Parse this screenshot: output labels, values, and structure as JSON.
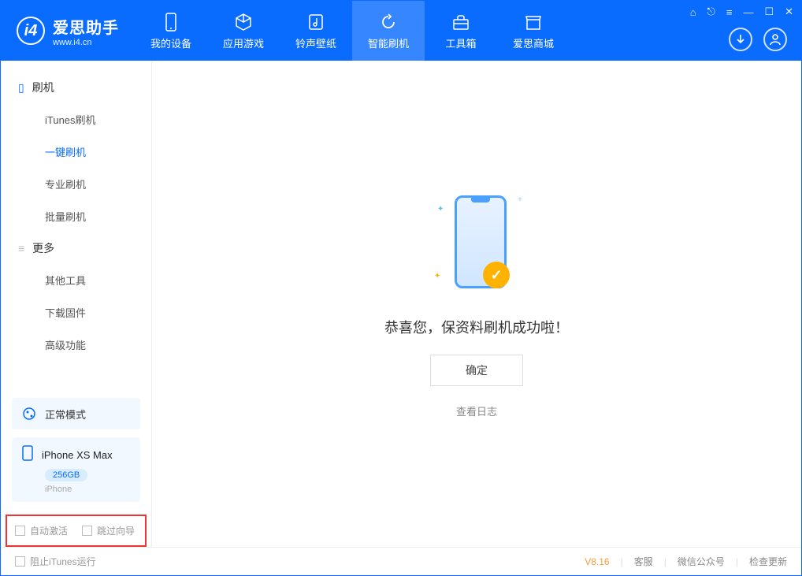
{
  "app": {
    "title": "爱思助手",
    "subtitle": "www.i4.cn"
  },
  "tabs": [
    {
      "label": "我的设备",
      "icon": "phone-icon"
    },
    {
      "label": "应用游戏",
      "icon": "cube-icon"
    },
    {
      "label": "铃声壁纸",
      "icon": "music-icon"
    },
    {
      "label": "智能刷机",
      "icon": "refresh-icon"
    },
    {
      "label": "工具箱",
      "icon": "toolbox-icon"
    },
    {
      "label": "爱思商城",
      "icon": "store-icon"
    }
  ],
  "sidebar": {
    "group1": {
      "title": "刷机",
      "items": [
        "iTunes刷机",
        "一键刷机",
        "专业刷机",
        "批量刷机"
      ],
      "activeIndex": 1
    },
    "group2": {
      "title": "更多",
      "items": [
        "其他工具",
        "下载固件",
        "高级功能"
      ]
    },
    "mode": {
      "label": "正常模式"
    },
    "device": {
      "name": "iPhone XS Max",
      "storage": "256GB",
      "type": "iPhone"
    },
    "checks": {
      "auto_activate": "自动激活",
      "skip_guide": "跳过向导"
    }
  },
  "main": {
    "success_text": "恭喜您，保资料刷机成功啦！",
    "ok_button": "确定",
    "view_log": "查看日志"
  },
  "footer": {
    "block_itunes": "阻止iTunes运行",
    "version": "V8.16",
    "links": [
      "客服",
      "微信公众号",
      "检查更新"
    ]
  }
}
